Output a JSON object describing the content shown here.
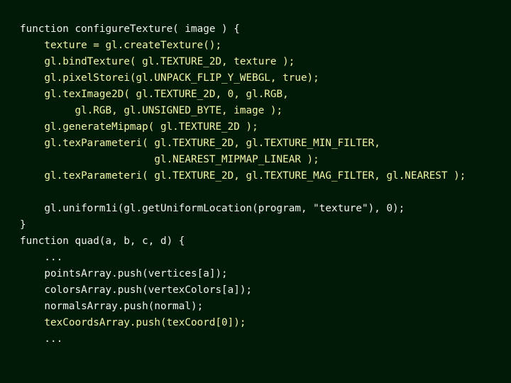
{
  "colors": {
    "background": "#011a08",
    "code_white": "#f2f2ee",
    "code_yellow": "#f4f4a6"
  },
  "code": {
    "lines": [
      {
        "text": "function configureTexture( image ) {",
        "color": "white"
      },
      {
        "text": "    texture = gl.createTexture();",
        "color": "yellow"
      },
      {
        "text": "    gl.bindTexture( gl.TEXTURE_2D, texture );",
        "color": "yellow"
      },
      {
        "text": "    gl.pixelStorei(gl.UNPACK_FLIP_Y_WEBGL, true);",
        "color": "yellow"
      },
      {
        "text": "    gl.texImage2D( gl.TEXTURE_2D, 0, gl.RGB,",
        "color": "yellow"
      },
      {
        "text": "         gl.RGB, gl.UNSIGNED_BYTE, image );",
        "color": "yellow"
      },
      {
        "text": "    gl.generateMipmap( gl.TEXTURE_2D );",
        "color": "yellow"
      },
      {
        "text": "    gl.texParameteri( gl.TEXTURE_2D, gl.TEXTURE_MIN_FILTER,",
        "color": "yellow"
      },
      {
        "text": "                      gl.NEAREST_MIPMAP_LINEAR );",
        "color": "yellow"
      },
      {
        "text": "    gl.texParameteri( gl.TEXTURE_2D, gl.TEXTURE_MAG_FILTER, gl.NEAREST );",
        "color": "yellow"
      },
      {
        "text": "",
        "color": "white"
      },
      {
        "text": "    gl.uniform1i(gl.getUniformLocation(program, \"texture\"), 0);",
        "color": "white"
      },
      {
        "text": "}",
        "color": "white"
      },
      {
        "text": "function quad(a, b, c, d) {",
        "color": "white"
      },
      {
        "text": "    ...",
        "color": "white"
      },
      {
        "text": "    pointsArray.push(vertices[a]);",
        "color": "white"
      },
      {
        "text": "    colorsArray.push(vertexColors[a]);",
        "color": "white"
      },
      {
        "text": "    normalsArray.push(normal);",
        "color": "white"
      },
      {
        "text": "    texCoordsArray.push(texCoord[0]);",
        "color": "yellow"
      },
      {
        "text": "    ...",
        "color": "white"
      }
    ]
  }
}
